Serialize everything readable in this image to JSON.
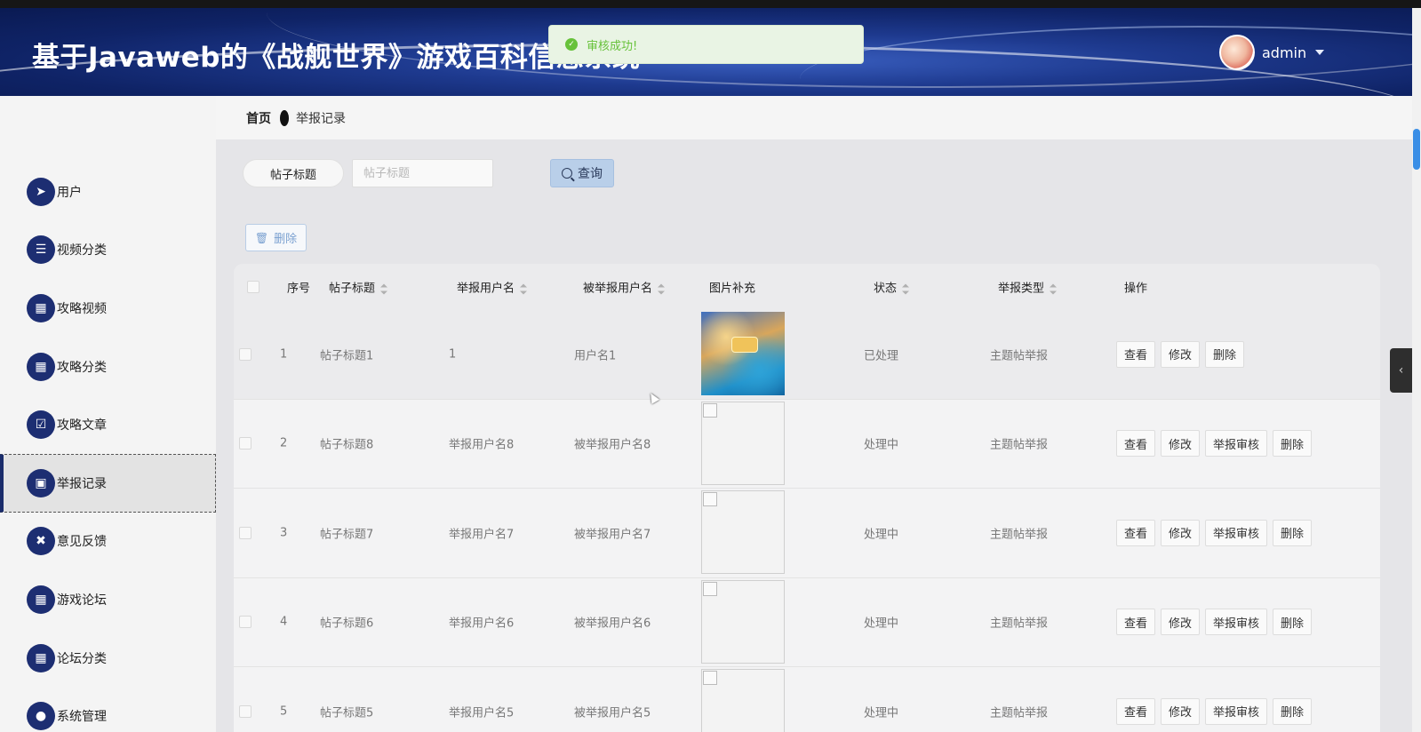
{
  "header": {
    "app_title": "基于Javaweb的《战舰世界》游戏百科信息系统",
    "username": "admin"
  },
  "toast": {
    "message": "审核成功!"
  },
  "sidebar": {
    "items": [
      {
        "label": "用户",
        "icon": "paper-plane-icon",
        "glyph": "➤"
      },
      {
        "label": "视频分类",
        "icon": "list-icon",
        "glyph": "☰"
      },
      {
        "label": "攻略视频",
        "icon": "grid-icon",
        "glyph": "▦"
      },
      {
        "label": "攻略分类",
        "icon": "grid-icon",
        "glyph": "▦"
      },
      {
        "label": "攻略文章",
        "icon": "clipboard-check-icon",
        "glyph": "☑"
      },
      {
        "label": "举报记录",
        "icon": "briefcase-icon",
        "glyph": "▣"
      },
      {
        "label": "意见反馈",
        "icon": "ticket-icon",
        "glyph": "✖"
      },
      {
        "label": "游戏论坛",
        "icon": "grid-icon",
        "glyph": "▦"
      },
      {
        "label": "论坛分类",
        "icon": "grid-icon",
        "glyph": "▦"
      },
      {
        "label": "系统管理",
        "icon": "user-icon",
        "glyph": "●"
      }
    ],
    "active_index": 5
  },
  "breadcrumb": {
    "home": "首页",
    "current": "举报记录"
  },
  "search": {
    "label": "帖子标题",
    "placeholder": "帖子标题",
    "query_button": "查询"
  },
  "toolbar": {
    "delete_label": "删除"
  },
  "table": {
    "headers": {
      "index": "序号",
      "title": "帖子标题",
      "reporter": "举报用户名",
      "reported": "被举报用户名",
      "image": "图片补充",
      "status": "状态",
      "type": "举报类型",
      "actions": "操作"
    },
    "rows": [
      {
        "index": "1",
        "title": "帖子标题1",
        "reporter": "1",
        "reported": "用户名1",
        "status": "已处理",
        "type": "主题帖举报",
        "has_image": true,
        "actions": [
          "查看",
          "修改",
          "删除"
        ]
      },
      {
        "index": "2",
        "title": "帖子标题8",
        "reporter": "举报用户名8",
        "reported": "被举报用户名8",
        "status": "处理中",
        "type": "主题帖举报",
        "has_image": false,
        "actions": [
          "查看",
          "修改",
          "举报审核",
          "删除"
        ]
      },
      {
        "index": "3",
        "title": "帖子标题7",
        "reporter": "举报用户名7",
        "reported": "被举报用户名7",
        "status": "处理中",
        "type": "主题帖举报",
        "has_image": false,
        "actions": [
          "查看",
          "修改",
          "举报审核",
          "删除"
        ]
      },
      {
        "index": "4",
        "title": "帖子标题6",
        "reporter": "举报用户名6",
        "reported": "被举报用户名6",
        "status": "处理中",
        "type": "主题帖举报",
        "has_image": false,
        "actions": [
          "查看",
          "修改",
          "举报审核",
          "删除"
        ]
      },
      {
        "index": "5",
        "title": "帖子标题5",
        "reporter": "举报用户名5",
        "reported": "被举报用户名5",
        "status": "处理中",
        "type": "主题帖举报",
        "has_image": false,
        "actions": [
          "查看",
          "修改",
          "举报审核",
          "删除"
        ]
      }
    ]
  },
  "side_tab": {
    "glyph": "‹"
  }
}
